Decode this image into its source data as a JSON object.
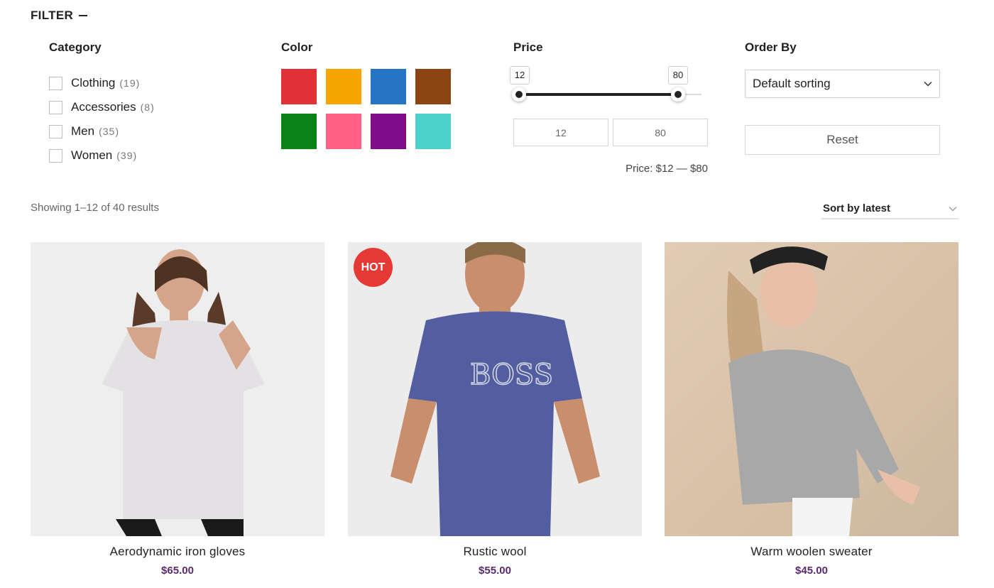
{
  "filter": {
    "title": "FILTER"
  },
  "category": {
    "title": "Category",
    "items": [
      {
        "label": "Clothing",
        "count": "(19)"
      },
      {
        "label": "Accessories",
        "count": "(8)"
      },
      {
        "label": "Men",
        "count": "(35)"
      },
      {
        "label": "Women",
        "count": "(39)"
      }
    ]
  },
  "color": {
    "title": "Color",
    "swatches": [
      "#e03236",
      "#f7a501",
      "#2575c4",
      "#8b4513",
      "#0a8216",
      "#ff5f82",
      "#800c8a",
      "#4dd1cc"
    ]
  },
  "price": {
    "title": "Price",
    "min": "12",
    "max": "80",
    "range_min": 0,
    "range_max": 100,
    "label": "Price: $12 — $80"
  },
  "order": {
    "title": "Order By",
    "selected": "Default sorting",
    "reset_label": "Reset"
  },
  "results": {
    "text": "Showing 1–12 of 40 results",
    "sort_selected": "Sort by latest"
  },
  "products": [
    {
      "name": "Aerodynamic iron gloves",
      "price": "$65.00",
      "badge": ""
    },
    {
      "name": "Rustic wool",
      "price": "$55.00",
      "badge": "HOT"
    },
    {
      "name": "Warm woolen sweater",
      "price": "$45.00",
      "badge": ""
    }
  ],
  "colors": {
    "accent": "#5b2a6e",
    "badge": "#e53935"
  }
}
